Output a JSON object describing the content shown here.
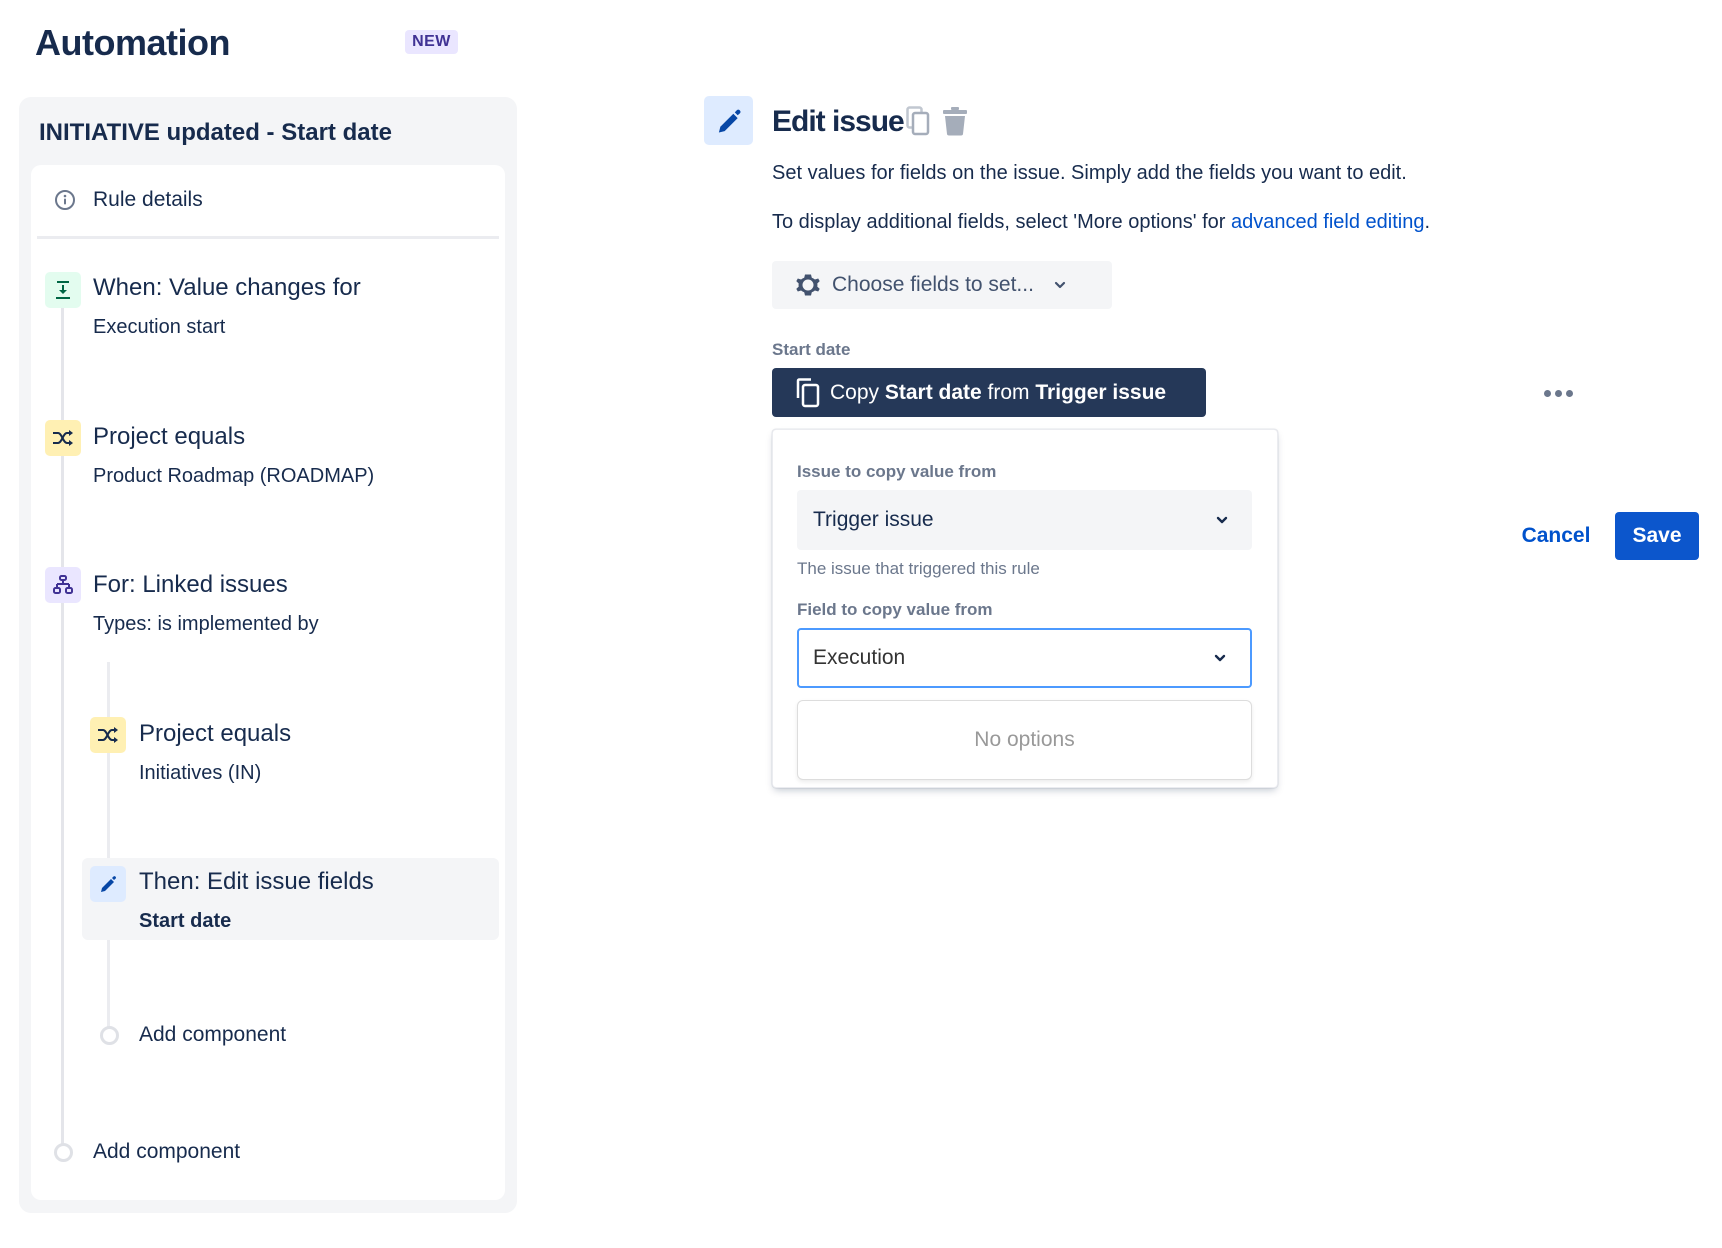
{
  "header": {
    "title": "Automation",
    "badge": "NEW"
  },
  "rule": {
    "name": "INITIATIVE updated - Start date",
    "details_label": "Rule details",
    "components": [
      {
        "type": "trigger",
        "icon": "field-change-icon",
        "title": "When: Value changes for",
        "subtitle": "Execution start",
        "accent": "#e3fcef"
      },
      {
        "type": "condition",
        "icon": "shuffle-icon",
        "title": "Project equals",
        "subtitle": "Product Roadmap (ROADMAP)",
        "accent": "#fff0b3"
      },
      {
        "type": "branch",
        "icon": "hierarchy-icon",
        "title": "For: Linked issues",
        "subtitle": "Types: is implemented by",
        "accent": "#eae6ff"
      },
      {
        "type": "condition",
        "icon": "shuffle-icon",
        "title": "Project equals",
        "subtitle": "Initiatives (IN)",
        "accent": "#fff0b3",
        "nested": true
      },
      {
        "type": "action",
        "icon": "pencil-icon",
        "title": "Then: Edit issue fields",
        "subtitle": "Start date",
        "accent": "#deebff",
        "nested": true,
        "selected": true
      }
    ],
    "add_component_nested": "Add component",
    "add_component": "Add component"
  },
  "editor": {
    "title": "Edit issue",
    "icon": "pencil-icon",
    "description": "Set values for fields on the issue. Simply add the fields you want to edit.",
    "more_info_prefix": "To display additional fields, select 'More options' for ",
    "more_info_link": "advanced field editing",
    "more_info_suffix": ".",
    "choose_fields_label": "Choose fields to set...",
    "field": {
      "label": "Start date",
      "copy_prefix": "Copy ",
      "copy_field": "Start date",
      "copy_mid": " from ",
      "copy_source": "Trigger issue"
    },
    "popup": {
      "issue_label": "Issue to copy value from",
      "issue_value": "Trigger issue",
      "issue_helper": "The issue that triggered this rule",
      "field_label": "Field to copy value from",
      "field_input_value": "Execution",
      "menu_empty": "No options"
    },
    "cancel_label": "Cancel",
    "save_label": "Save"
  },
  "colors": {
    "primary": "#0c56cc",
    "link": "#0052cc",
    "text": "#172b4d",
    "focus": "#4c9aff",
    "dark_button": "#253858"
  }
}
